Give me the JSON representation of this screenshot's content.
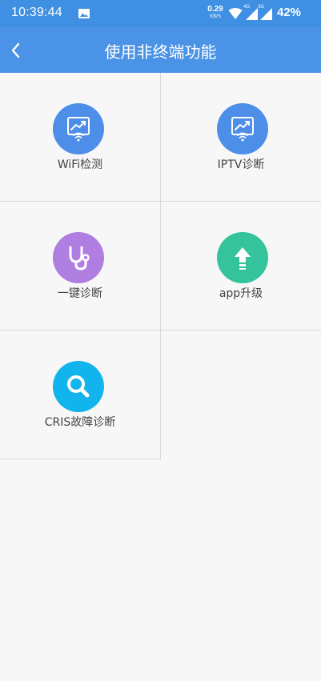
{
  "status_bar": {
    "time": "10:39:44",
    "speed_value": "0.29",
    "speed_unit": "KB/S",
    "net1": "4G",
    "net2": "3G",
    "battery": "42%"
  },
  "header": {
    "title": "使用非终端功能",
    "back_icon": "chevron-left-icon"
  },
  "colors": {
    "status_bar": "#3f8fe3",
    "app_bar": "#4a93e6",
    "background": "#f7f7f7",
    "wifi_tile_icon": "#4d8ee8",
    "iptv_tile_icon": "#4d8ee8",
    "one_key_icon": "#b07ee0",
    "upgrade_icon": "#34c39a",
    "cris_icon": "#11b4ec"
  },
  "tiles": [
    {
      "label": "WiFi检测",
      "icon": "wifi-chart-icon"
    },
    {
      "label": "IPTV诊断",
      "icon": "wifi-chart-icon"
    },
    {
      "label": "一键诊断",
      "icon": "stethoscope-icon"
    },
    {
      "label": "app升级",
      "icon": "upload-arrow-icon"
    },
    {
      "label": "CRIS故障诊断",
      "icon": "search-icon"
    }
  ]
}
